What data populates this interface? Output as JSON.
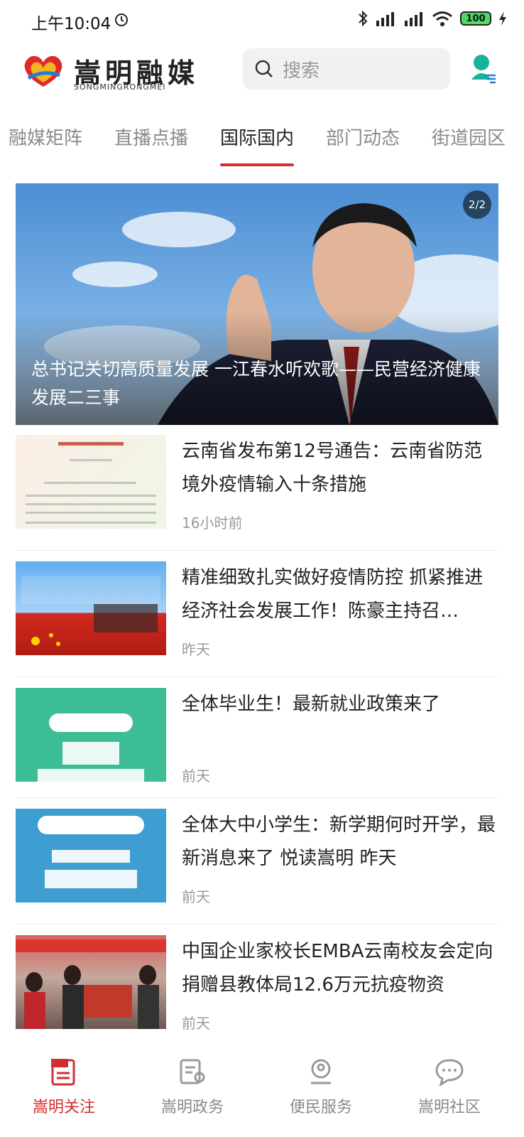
{
  "status_bar": {
    "time": "上午10:04",
    "battery": "100"
  },
  "header": {
    "brand_name": "嵩明融媒",
    "brand_sub": "SONGMINGRONGMEI",
    "search_placeholder": "搜索"
  },
  "tabs": [
    {
      "label": "融媒矩阵",
      "active": false
    },
    {
      "label": "直播点播",
      "active": false
    },
    {
      "label": "国际国内",
      "active": true
    },
    {
      "label": "部门动态",
      "active": false
    },
    {
      "label": "街道园区",
      "active": false
    }
  ],
  "hero": {
    "caption": "总书记关切高质量发展 一江春水听欢歌——民营经济健康发展二三事",
    "pager": "2/2"
  },
  "news": [
    {
      "title": "云南省发布第12号通告：云南省防范境外疫情输入十条措施",
      "time": "16小时前"
    },
    {
      "title": "精准细致扎实做好疫情防控 抓紧推进经济社会发展工作！陈豪主持召…",
      "time": "昨天"
    },
    {
      "title": "全体毕业生！最新就业政策来了",
      "time": "前天"
    },
    {
      "title": "全体大中小学生：新学期何时开学，最新消息来了 悦读嵩明 昨天",
      "time": "前天"
    },
    {
      "title": "中国企业家校长EMBA云南校友会定向捐赠县教体局12.6万元抗疫物资",
      "time": "前天"
    }
  ],
  "bottom_nav": [
    {
      "label": "嵩明关注",
      "active": true
    },
    {
      "label": "嵩明政务",
      "active": false
    },
    {
      "label": "便民服务",
      "active": false
    },
    {
      "label": "嵩明社区",
      "active": false
    }
  ],
  "colors": {
    "accent": "#d12f2f",
    "inactive": "#8a8a8a"
  }
}
